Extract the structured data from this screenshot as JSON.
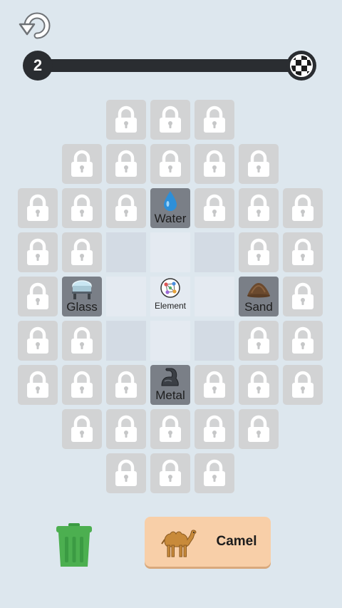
{
  "level": "2",
  "board": {
    "center_label": "Element",
    "elements": {
      "water": "Water",
      "glass": "Glass",
      "sand": "Sand",
      "metal": "Metal"
    }
  },
  "result": {
    "label": "Camel",
    "icon": "camel-icon"
  },
  "icons": {
    "undo": "undo-icon",
    "finish": "checkered-flag-icon",
    "lock": "lock-icon",
    "trash": "trash-can-icon"
  },
  "colors": {
    "trash": "#4caf50",
    "result_bg": "#f8cfa8",
    "locked_tile": "#d2d3d4",
    "element_tile": "#7a7f87"
  }
}
